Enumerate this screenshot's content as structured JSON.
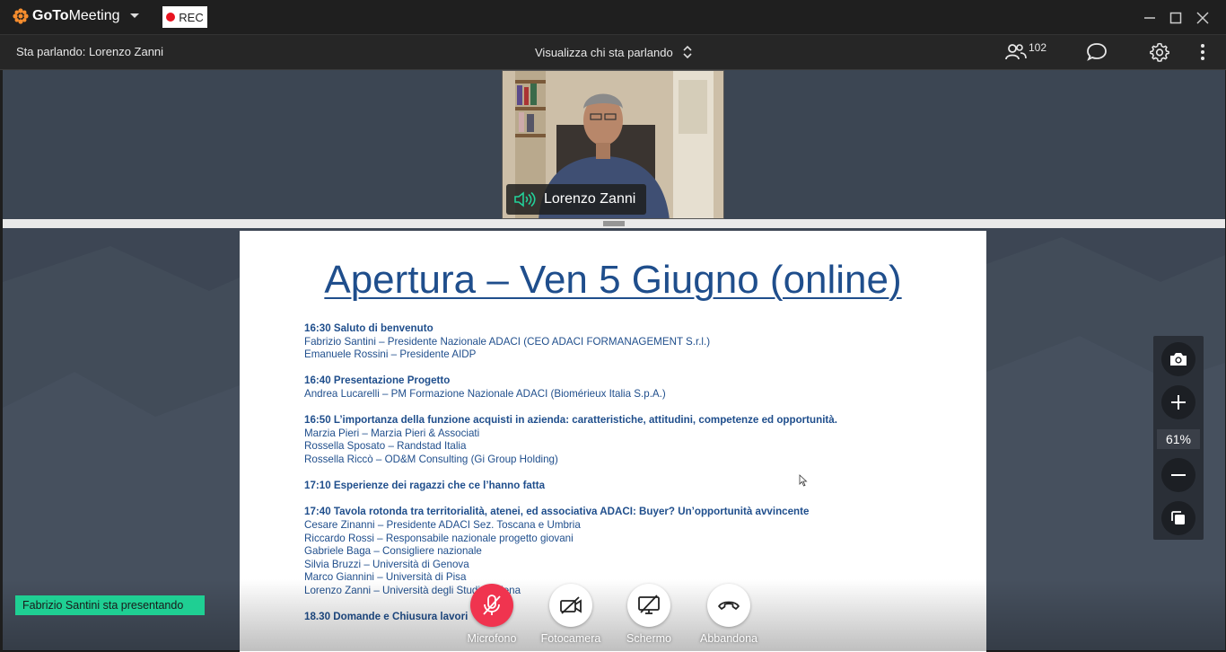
{
  "app": {
    "brand_bold": "GoTo",
    "brand_rest": "Meeting",
    "rec_label": "REC",
    "brand_color": "#f68d2e",
    "rec_color": "#e8131f"
  },
  "topbar": {
    "speaking_label": "Sta parlando: Lorenzo Zanni",
    "view_mode": "Visualizza chi sta parlando",
    "participant_count": "102"
  },
  "video": {
    "speaker_name": "Lorenzo Zanni"
  },
  "slide": {
    "title": "Apertura – Ven 5 Giugno (online)",
    "sections": [
      {
        "heading": "16:30 Saluto di benvenuto",
        "lines": [
          "Fabrizio Santini – Presidente Nazionale ADACI (CEO ADACI FORMANAGEMENT S.r.l.)",
          "Emanuele Rossini – Presidente AIDP"
        ]
      },
      {
        "heading": "16:40 Presentazione Progetto",
        "lines": [
          "Andrea Lucarelli – PM Formazione Nazionale ADACI (Biomérieux Italia S.p.A.)"
        ]
      },
      {
        "heading": "16:50   L’importanza della funzione acquisti in azienda: caratteristiche, attitudini, competenze ed opportunità.",
        "lines": [
          "Marzia Pieri – Marzia Pieri & Associati",
          "Rossella Sposato – Randstad Italia",
          "Rossella Riccò – OD&M Consulting (Gi Group Holding)"
        ]
      },
      {
        "heading": "17:10   Esperienze dei ragazzi che ce l’hanno fatta",
        "lines": []
      },
      {
        "heading": "17:40 Tavola rotonda tra territorialità, atenei, ed associativa ADACI: Buyer? Un’opportunità avvincente",
        "lines": [
          "Cesare Zinanni – Presidente ADACI Sez. Toscana e Umbria",
          "Riccardo Rossi – Responsabile nazionale progetto giovani",
          "Gabriele Baga – Consigliere nazionale",
          "Silvia Bruzzi – Università di Genova",
          "Marco Giannini – Università di Pisa",
          "Lorenzo Zanni – Università degli Studi di Siena"
        ]
      },
      {
        "heading": "18.30   Domande e Chiusura lavori",
        "lines": []
      }
    ]
  },
  "zoom": {
    "level": "61%"
  },
  "presenter_banner": "Fabrizio Santini sta presentando",
  "controls": {
    "mic": "Microfono",
    "camera": "Fotocamera",
    "screen": "Schermo",
    "leave": "Abbandona"
  }
}
